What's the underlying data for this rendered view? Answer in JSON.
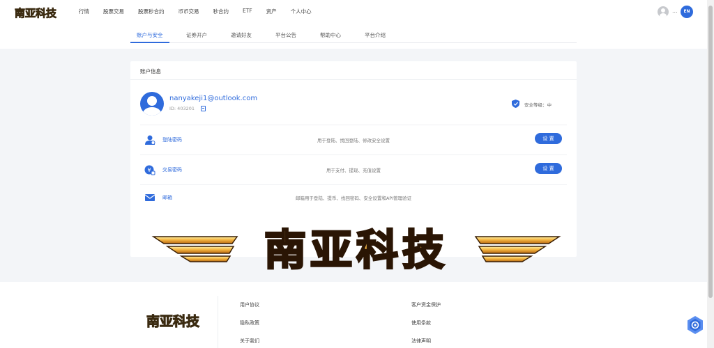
{
  "brand": {
    "logo_text": "南亚科技"
  },
  "nav": {
    "items": [
      "行情",
      "股票交易",
      "股票秒合约",
      "币币交易",
      "秒合约",
      "ETF",
      "资产",
      "个人中心"
    ],
    "dots": "...",
    "lang": "EN"
  },
  "subtabs": {
    "items": [
      "账户与安全",
      "证券开户",
      "邀请好友",
      "平台公告",
      "帮助中心",
      "平台介绍"
    ],
    "active_index": 0
  },
  "account": {
    "title": "账户信息",
    "email": "nanyakeji1@outlook.com",
    "id_text": "ID: 403201",
    "security_level": "安全等级：中"
  },
  "rows": [
    {
      "label": "登陆密码",
      "desc": "用于登陆、找回登陆、修改安全设置",
      "button": "设 置",
      "icon": "login-user-icon"
    },
    {
      "label": "交易密码",
      "desc": "用于支付、提现、充值设置",
      "button": "设 置",
      "icon": "trade-lock-icon"
    },
    {
      "label": "邮箱",
      "desc": "邮箱用于登陆、提币、找回密码、安全设置和API管理验证",
      "button": "",
      "icon": "mail-icon"
    }
  ],
  "watermark": {
    "text": "南亚科技"
  },
  "footer": {
    "col1": [
      "用户协议",
      "隐私政策",
      "关于我们"
    ],
    "col2": [
      "客户资金保护",
      "使用条款",
      "法律声明"
    ]
  },
  "colors": {
    "accent": "#2f6bdc",
    "gold": "#f5b642",
    "bg": "#f3f5f8"
  }
}
